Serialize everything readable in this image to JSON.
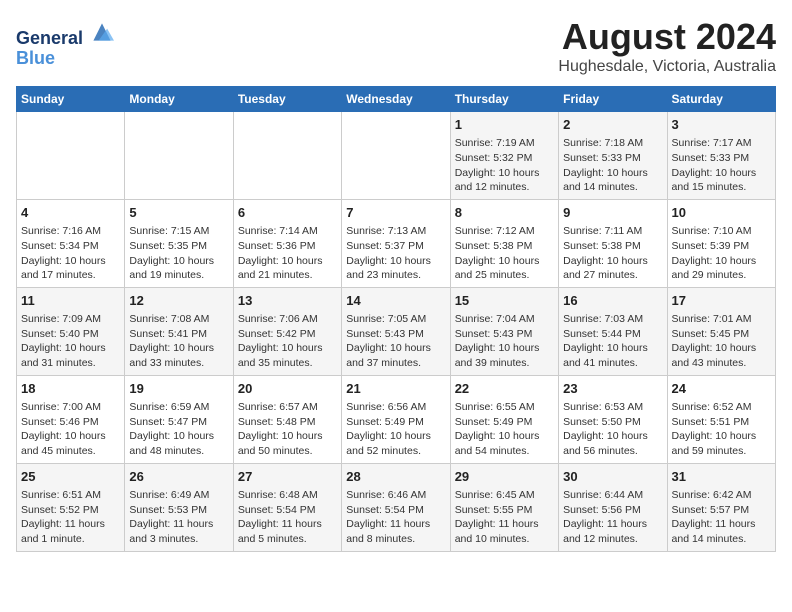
{
  "logo": {
    "line1": "General",
    "line2": "Blue"
  },
  "title": "August 2024",
  "subtitle": "Hughesdale, Victoria, Australia",
  "headers": [
    "Sunday",
    "Monday",
    "Tuesday",
    "Wednesday",
    "Thursday",
    "Friday",
    "Saturday"
  ],
  "weeks": [
    [
      {
        "day": "",
        "content": ""
      },
      {
        "day": "",
        "content": ""
      },
      {
        "day": "",
        "content": ""
      },
      {
        "day": "",
        "content": ""
      },
      {
        "day": "1",
        "content": "Sunrise: 7:19 AM\nSunset: 5:32 PM\nDaylight: 10 hours\nand 12 minutes."
      },
      {
        "day": "2",
        "content": "Sunrise: 7:18 AM\nSunset: 5:33 PM\nDaylight: 10 hours\nand 14 minutes."
      },
      {
        "day": "3",
        "content": "Sunrise: 7:17 AM\nSunset: 5:33 PM\nDaylight: 10 hours\nand 15 minutes."
      }
    ],
    [
      {
        "day": "4",
        "content": "Sunrise: 7:16 AM\nSunset: 5:34 PM\nDaylight: 10 hours\nand 17 minutes."
      },
      {
        "day": "5",
        "content": "Sunrise: 7:15 AM\nSunset: 5:35 PM\nDaylight: 10 hours\nand 19 minutes."
      },
      {
        "day": "6",
        "content": "Sunrise: 7:14 AM\nSunset: 5:36 PM\nDaylight: 10 hours\nand 21 minutes."
      },
      {
        "day": "7",
        "content": "Sunrise: 7:13 AM\nSunset: 5:37 PM\nDaylight: 10 hours\nand 23 minutes."
      },
      {
        "day": "8",
        "content": "Sunrise: 7:12 AM\nSunset: 5:38 PM\nDaylight: 10 hours\nand 25 minutes."
      },
      {
        "day": "9",
        "content": "Sunrise: 7:11 AM\nSunset: 5:38 PM\nDaylight: 10 hours\nand 27 minutes."
      },
      {
        "day": "10",
        "content": "Sunrise: 7:10 AM\nSunset: 5:39 PM\nDaylight: 10 hours\nand 29 minutes."
      }
    ],
    [
      {
        "day": "11",
        "content": "Sunrise: 7:09 AM\nSunset: 5:40 PM\nDaylight: 10 hours\nand 31 minutes."
      },
      {
        "day": "12",
        "content": "Sunrise: 7:08 AM\nSunset: 5:41 PM\nDaylight: 10 hours\nand 33 minutes."
      },
      {
        "day": "13",
        "content": "Sunrise: 7:06 AM\nSunset: 5:42 PM\nDaylight: 10 hours\nand 35 minutes."
      },
      {
        "day": "14",
        "content": "Sunrise: 7:05 AM\nSunset: 5:43 PM\nDaylight: 10 hours\nand 37 minutes."
      },
      {
        "day": "15",
        "content": "Sunrise: 7:04 AM\nSunset: 5:43 PM\nDaylight: 10 hours\nand 39 minutes."
      },
      {
        "day": "16",
        "content": "Sunrise: 7:03 AM\nSunset: 5:44 PM\nDaylight: 10 hours\nand 41 minutes."
      },
      {
        "day": "17",
        "content": "Sunrise: 7:01 AM\nSunset: 5:45 PM\nDaylight: 10 hours\nand 43 minutes."
      }
    ],
    [
      {
        "day": "18",
        "content": "Sunrise: 7:00 AM\nSunset: 5:46 PM\nDaylight: 10 hours\nand 45 minutes."
      },
      {
        "day": "19",
        "content": "Sunrise: 6:59 AM\nSunset: 5:47 PM\nDaylight: 10 hours\nand 48 minutes."
      },
      {
        "day": "20",
        "content": "Sunrise: 6:57 AM\nSunset: 5:48 PM\nDaylight: 10 hours\nand 50 minutes."
      },
      {
        "day": "21",
        "content": "Sunrise: 6:56 AM\nSunset: 5:49 PM\nDaylight: 10 hours\nand 52 minutes."
      },
      {
        "day": "22",
        "content": "Sunrise: 6:55 AM\nSunset: 5:49 PM\nDaylight: 10 hours\nand 54 minutes."
      },
      {
        "day": "23",
        "content": "Sunrise: 6:53 AM\nSunset: 5:50 PM\nDaylight: 10 hours\nand 56 minutes."
      },
      {
        "day": "24",
        "content": "Sunrise: 6:52 AM\nSunset: 5:51 PM\nDaylight: 10 hours\nand 59 minutes."
      }
    ],
    [
      {
        "day": "25",
        "content": "Sunrise: 6:51 AM\nSunset: 5:52 PM\nDaylight: 11 hours\nand 1 minute."
      },
      {
        "day": "26",
        "content": "Sunrise: 6:49 AM\nSunset: 5:53 PM\nDaylight: 11 hours\nand 3 minutes."
      },
      {
        "day": "27",
        "content": "Sunrise: 6:48 AM\nSunset: 5:54 PM\nDaylight: 11 hours\nand 5 minutes."
      },
      {
        "day": "28",
        "content": "Sunrise: 6:46 AM\nSunset: 5:54 PM\nDaylight: 11 hours\nand 8 minutes."
      },
      {
        "day": "29",
        "content": "Sunrise: 6:45 AM\nSunset: 5:55 PM\nDaylight: 11 hours\nand 10 minutes."
      },
      {
        "day": "30",
        "content": "Sunrise: 6:44 AM\nSunset: 5:56 PM\nDaylight: 11 hours\nand 12 minutes."
      },
      {
        "day": "31",
        "content": "Sunrise: 6:42 AM\nSunset: 5:57 PM\nDaylight: 11 hours\nand 14 minutes."
      }
    ]
  ]
}
